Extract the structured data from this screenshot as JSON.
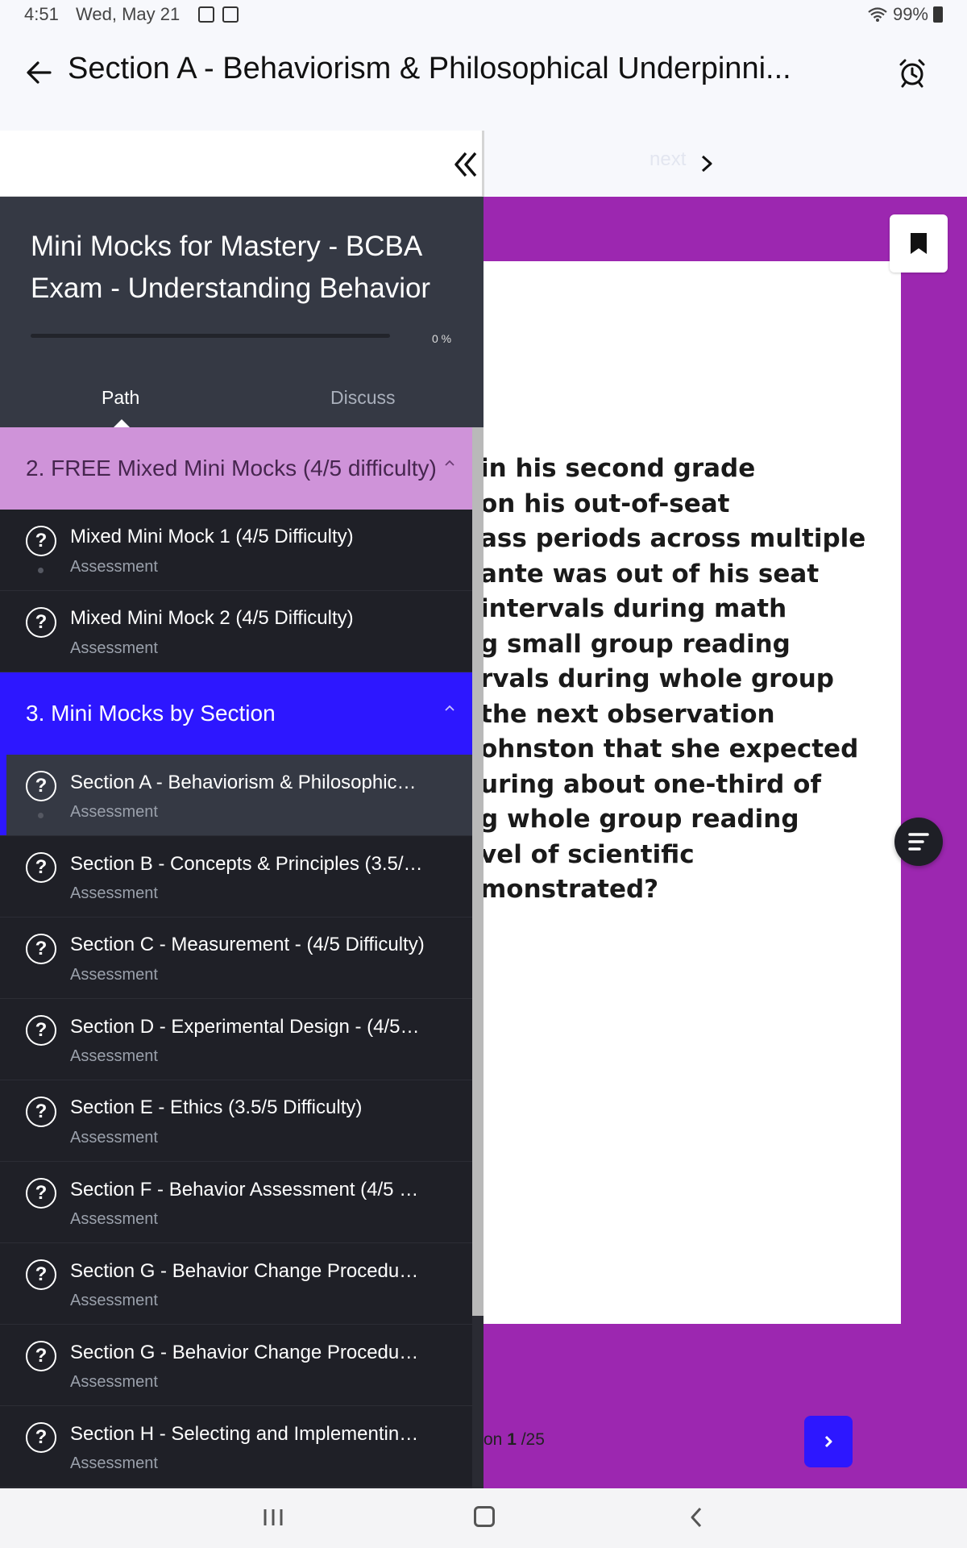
{
  "status_bar": {
    "time": "4:51",
    "date": "Wed, May 21",
    "battery": "99%"
  },
  "header": {
    "title": "Section A - Behaviorism & Philosophical Underpinni..."
  },
  "toolbar": {
    "next_label": "next"
  },
  "sidebar": {
    "course_title": "Mini Mocks for Mastery - BCBA Exam - Understanding Behavior",
    "progress_label": "0 %",
    "progress_fraction": 0,
    "tabs": [
      {
        "label": "Path",
        "active": true
      },
      {
        "label": "Discuss",
        "active": false
      }
    ],
    "sections": [
      {
        "label": "2. FREE Mixed Mini Mocks (4/5 difficulty)",
        "items": [
          {
            "title": "Mixed Mini Mock 1 (4/5 Difficulty)",
            "subtitle": "Assessment"
          },
          {
            "title": "Mixed Mini Mock 2 (4/5 Difficulty)",
            "subtitle": "Assessment"
          }
        ]
      },
      {
        "label": "3. Mini Mocks by Section",
        "items": [
          {
            "title": "Section A - Behaviorism & Philosophical⋯",
            "subtitle": "Assessment",
            "active": true
          },
          {
            "title": "Section B - Concepts & Principles (3.5/5 ⋯",
            "subtitle": "Assessment"
          },
          {
            "title": "Section C - Measurement - (4/5 Difficulty)",
            "subtitle": "Assessment"
          },
          {
            "title": "Section D - Experimental Design - (4/5 D⋯",
            "subtitle": "Assessment"
          },
          {
            "title": "Section E - Ethics (3.5/5 Difficulty)",
            "subtitle": "Assessment"
          },
          {
            "title": "Section F - Behavior Assessment (4/5 Di⋯",
            "subtitle": "Assessment"
          },
          {
            "title": "Section G - Behavior Change Procedure⋯",
            "subtitle": "Assessment"
          },
          {
            "title": "Section G - Behavior Change Procedure⋯",
            "subtitle": "Assessment"
          },
          {
            "title": "Section H - Selecting and Implementing⋯",
            "subtitle": "Assessment"
          }
        ]
      }
    ]
  },
  "question": {
    "visible_text": "in his second grade\non his out-of-seat\nass periods across multiple\nante was out of his seat\nintervals during math\ng small group reading\nrvals during whole group\nthe next observation\nohnston that she expected\nuring about one-third of\ng whole group reading\nvel of scientific\nmonstrated?",
    "counter_prefix": "on ",
    "counter_current": "1",
    "counter_total": " /25"
  },
  "colors": {
    "accent": "#2d17ff",
    "content_background": "#9c27b0",
    "sidebar_background": "#1f2027",
    "sidebar_header": "#353944",
    "free_section": "#cf93d9"
  },
  "icons": {
    "back": "arrow-left-icon",
    "alarm": "alarm-clock-icon",
    "collapse": "double-chevron-left-icon",
    "next": "chevron-right-icon",
    "bookmark": "bookmark-icon",
    "menu": "menu-lines-icon",
    "question": "question-circle-icon"
  }
}
